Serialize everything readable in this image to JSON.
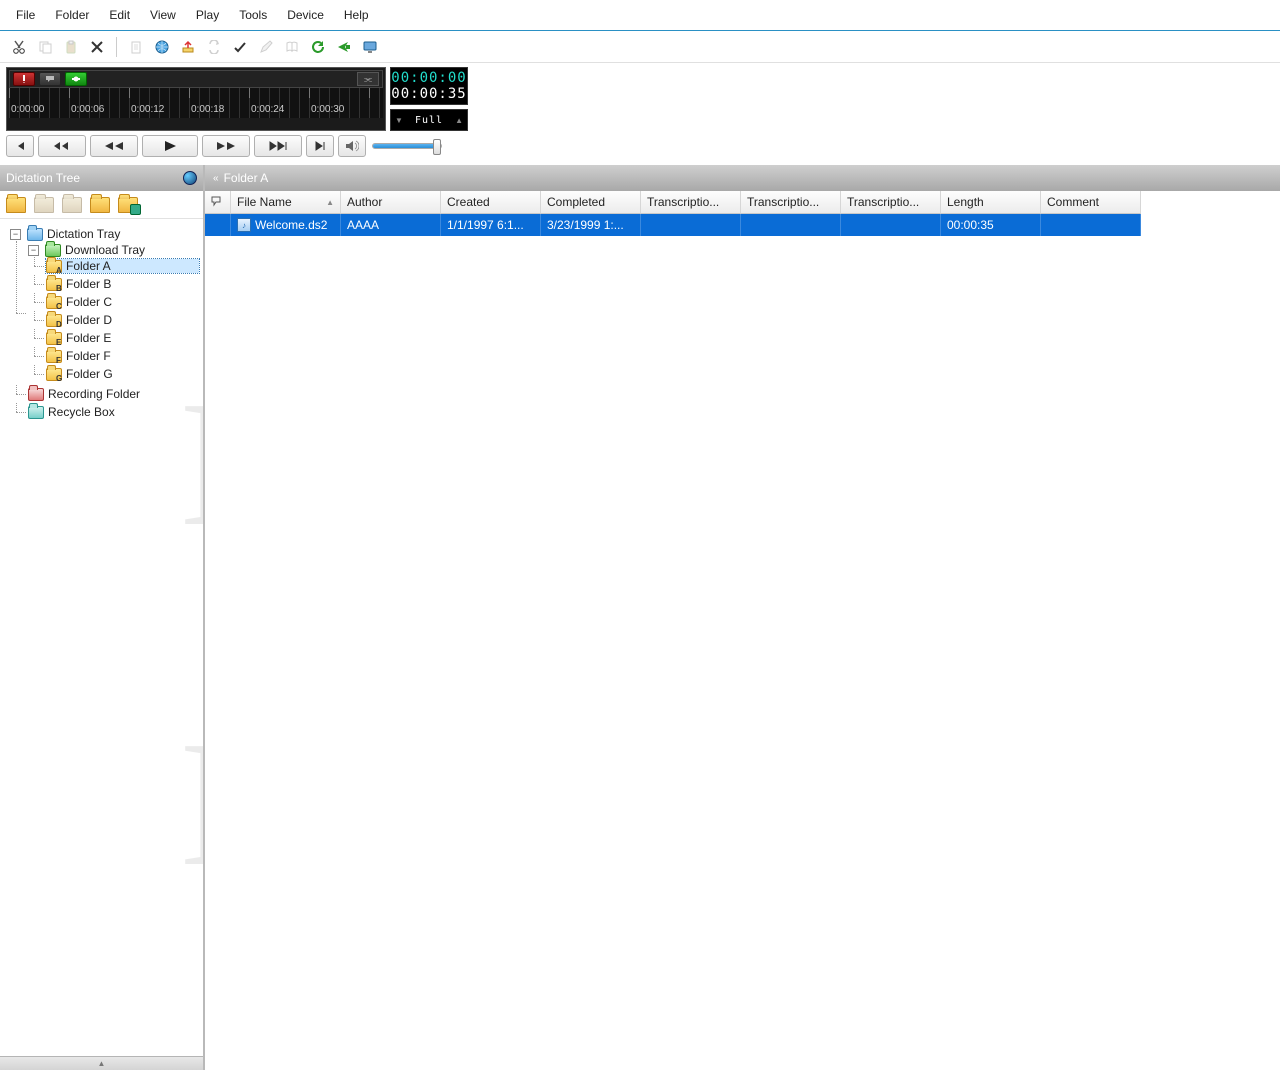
{
  "menu": [
    "File",
    "Folder",
    "Edit",
    "View",
    "Play",
    "Tools",
    "Device",
    "Help"
  ],
  "toolbar_icons": [
    "cut",
    "copy",
    "paste",
    "delete",
    "|",
    "new",
    "intranet",
    "upload",
    "convert",
    "check",
    "edit",
    "book",
    "refresh",
    "send",
    "screen"
  ],
  "player": {
    "time_current": "00:00:00",
    "time_total": "00:00:35",
    "ruler": [
      "0:00:00",
      "0:00:06",
      "0:00:12",
      "0:00:18",
      "0:00:24",
      "0:00:30"
    ],
    "full_label": "Full"
  },
  "sidebar": {
    "title": "Dictation Tree",
    "nodes": {
      "root": "Dictation Tray",
      "download": "Download Tray",
      "folders": [
        "Folder A",
        "Folder B",
        "Folder C",
        "Folder D",
        "Folder E",
        "Folder F",
        "Folder G"
      ],
      "folder_tags": [
        "A",
        "B",
        "C",
        "D",
        "E",
        "F",
        "G"
      ],
      "recording": "Recording Folder",
      "recycle": "Recycle Box"
    }
  },
  "content": {
    "breadcrumb": "Folder A",
    "columns": [
      "",
      "File Name",
      "Author",
      "Created",
      "Completed",
      "Transcriptio...",
      "Transcriptio...",
      "Transcriptio...",
      "Length",
      "Comment"
    ],
    "row": {
      "file_name": "Welcome.ds2",
      "author": "AAAA",
      "created": "1/1/1997 6:1...",
      "completed": "3/23/1999 1:...",
      "t1": "",
      "t2": "",
      "t3": "",
      "length": "00:00:35",
      "comment": ""
    }
  },
  "watermark": "Martel"
}
